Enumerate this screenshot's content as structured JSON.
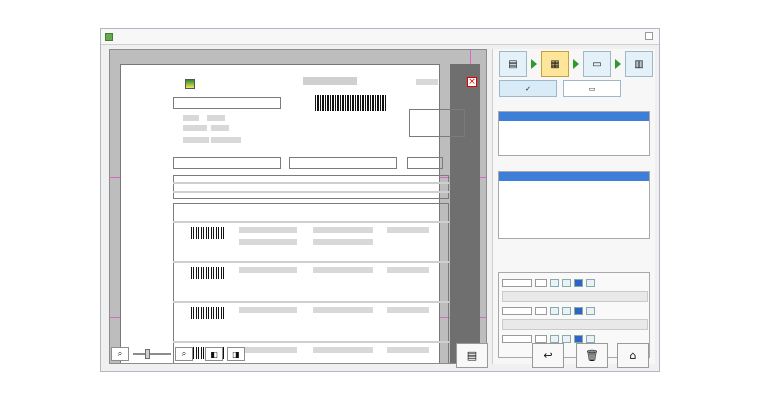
{
  "window": {
    "accent": "#d966c8",
    "selection": "#3d7fd8"
  },
  "step_bar": {
    "steps": [
      {
        "icon": "clipboard-icon"
      },
      {
        "icon": "form-icon"
      },
      {
        "icon": "monitor-icon"
      },
      {
        "icon": "print-icon"
      }
    ],
    "active_step_index": 1
  },
  "preview": {
    "zoom_level": 0.5
  }
}
